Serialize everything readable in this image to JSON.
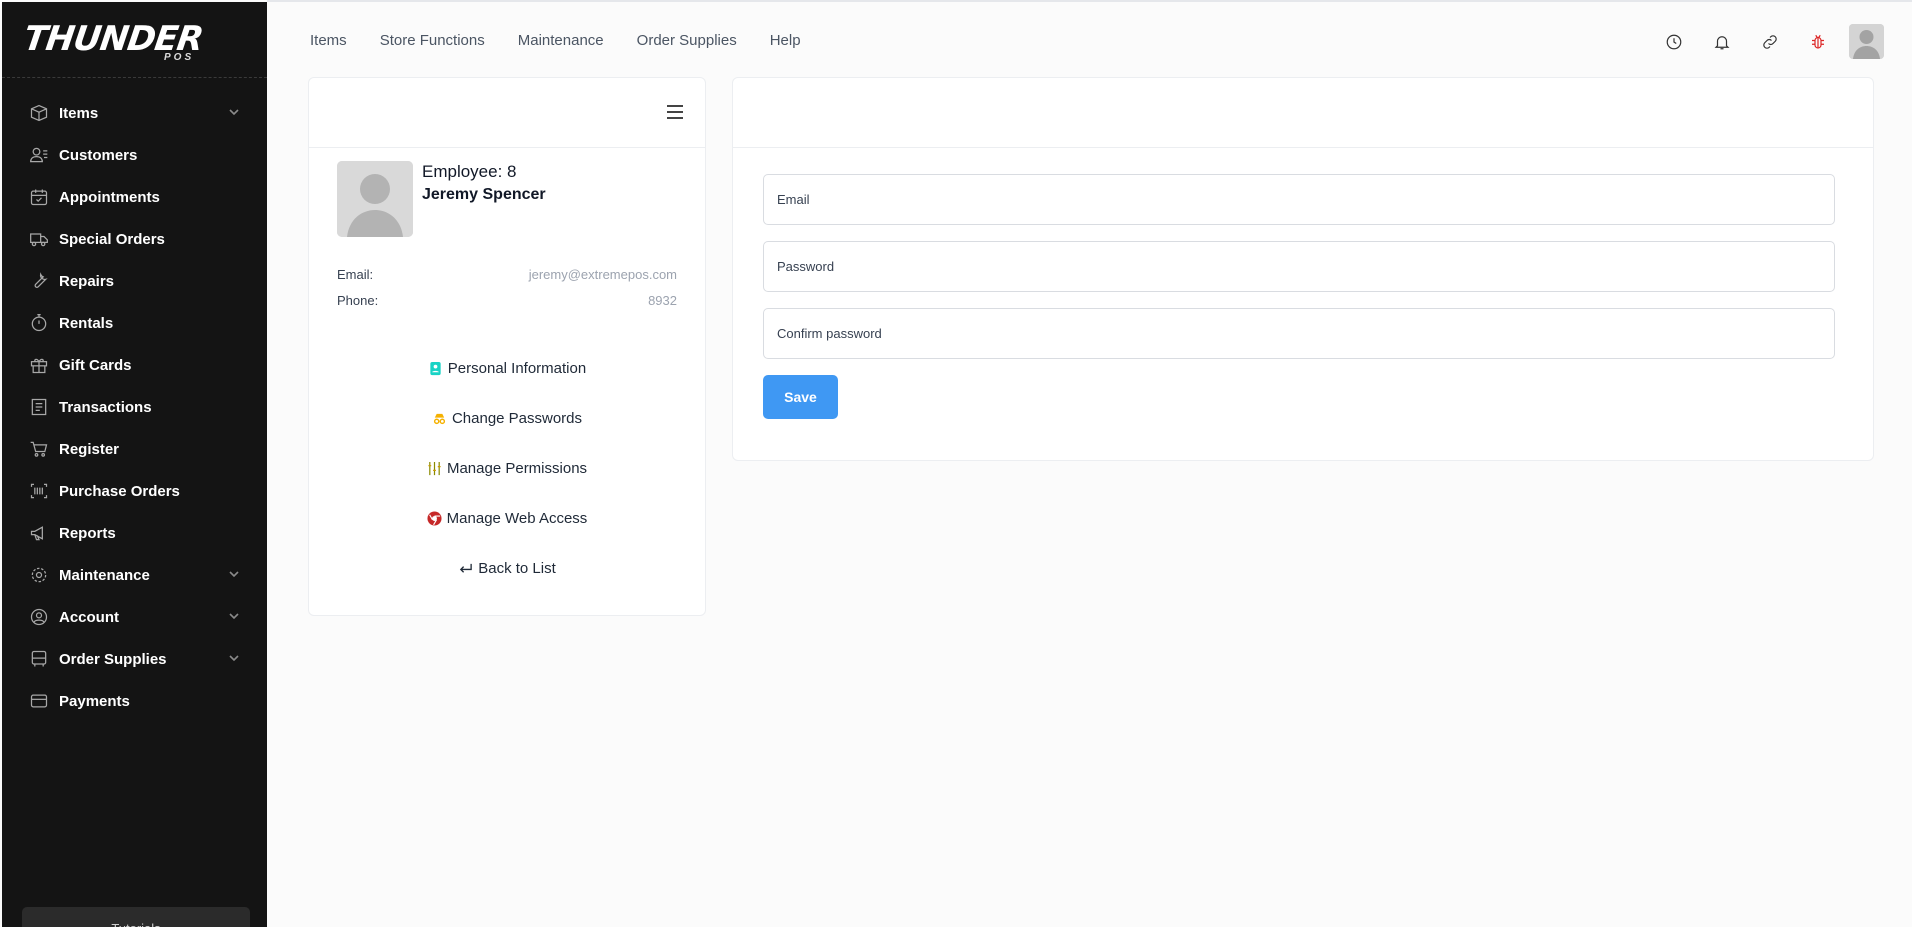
{
  "brand": {
    "name": "THUNDER",
    "sub": "POS"
  },
  "sidebar": {
    "items": [
      {
        "label": "Items",
        "icon": "box-icon",
        "chevron": true
      },
      {
        "label": "Customers",
        "icon": "users-icon",
        "chevron": false
      },
      {
        "label": "Appointments",
        "icon": "calendar-icon",
        "chevron": false
      },
      {
        "label": "Special Orders",
        "icon": "truck-icon",
        "chevron": false
      },
      {
        "label": "Repairs",
        "icon": "wrench-icon",
        "chevron": false
      },
      {
        "label": "Rentals",
        "icon": "stopwatch-icon",
        "chevron": false
      },
      {
        "label": "Gift Cards",
        "icon": "gift-icon",
        "chevron": false
      },
      {
        "label": "Transactions",
        "icon": "receipt-icon",
        "chevron": false
      },
      {
        "label": "Register",
        "icon": "cart-icon",
        "chevron": false
      },
      {
        "label": "Purchase Orders",
        "icon": "barcode-icon",
        "chevron": false
      },
      {
        "label": "Reports",
        "icon": "megaphone-icon",
        "chevron": false
      },
      {
        "label": "Maintenance",
        "icon": "gear-icon",
        "chevron": true
      },
      {
        "label": "Account",
        "icon": "user-circle-icon",
        "chevron": true
      },
      {
        "label": "Order Supplies",
        "icon": "bus-icon",
        "chevron": true
      },
      {
        "label": "Payments",
        "icon": "credit-card-icon",
        "chevron": false
      }
    ],
    "tutorials": "Tutorials"
  },
  "topnav": {
    "links": [
      "Items",
      "Store Functions",
      "Maintenance",
      "Order Supplies",
      "Help"
    ],
    "icons": [
      "clock-icon",
      "bell-icon",
      "link-icon",
      "bug-icon"
    ]
  },
  "employee": {
    "title": "Employee: 8",
    "name": "Jeremy Spencer",
    "email_label": "Email:",
    "email": "jeremy@extremepos.com",
    "phone_label": "Phone:",
    "phone": "8932"
  },
  "menu": {
    "personal": "Personal Information",
    "passwords": "Change Passwords",
    "permissions": "Manage Permissions",
    "web_access": "Manage Web Access",
    "back": "Back to List"
  },
  "form": {
    "email_placeholder": "Email",
    "password_placeholder": "Password",
    "confirm_placeholder": "Confirm password",
    "save_label": "Save"
  },
  "colors": {
    "sidebar_bg": "#141414",
    "save_button": "#3f98f3"
  }
}
